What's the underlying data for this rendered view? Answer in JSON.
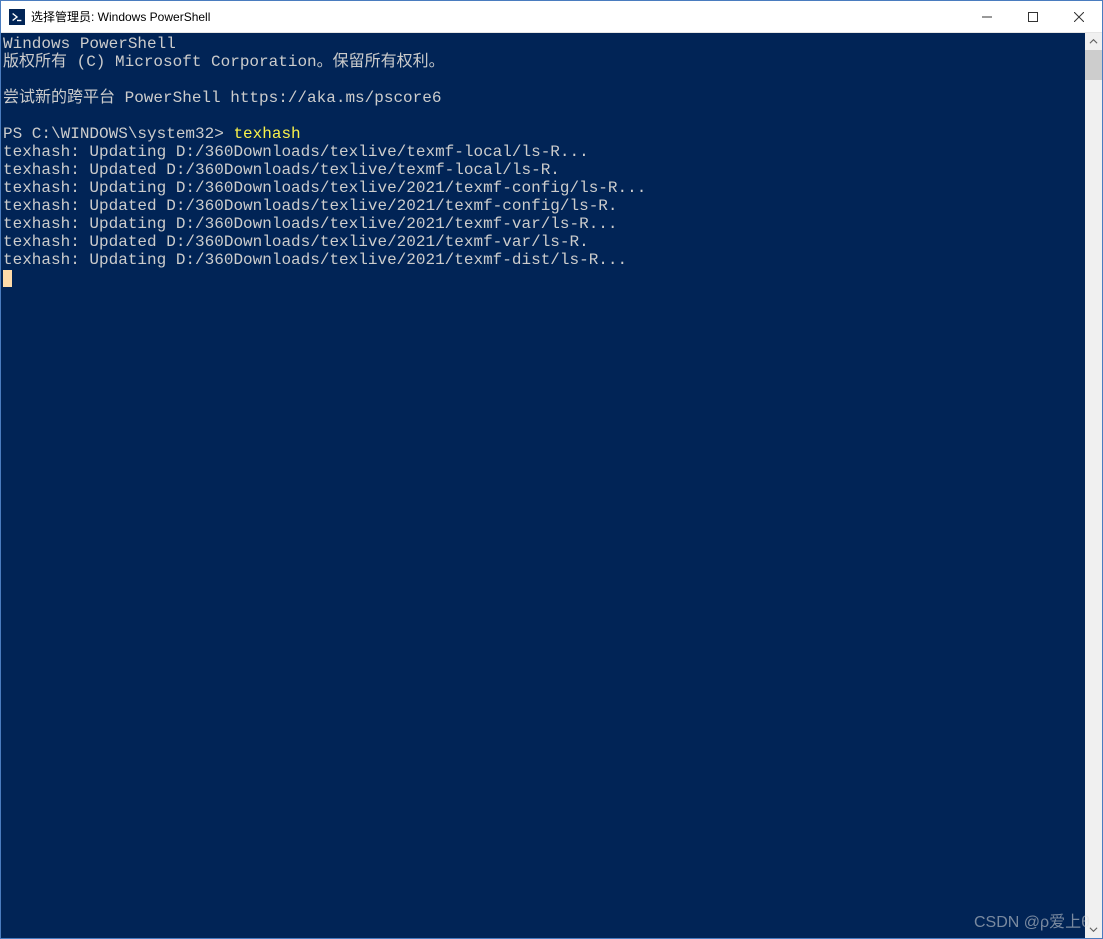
{
  "window": {
    "title": "选择管理员: Windows PowerShell"
  },
  "terminal": {
    "header1": "Windows PowerShell",
    "header2": "版权所有 (C) Microsoft Corporation。保留所有权利。",
    "tryline": "尝试新的跨平台 PowerShell https://aka.ms/pscore6",
    "prompt": "PS C:\\WINDOWS\\system32> ",
    "command": "texhash",
    "output": [
      "texhash: Updating D:/360Downloads/texlive/texmf-local/ls-R...",
      "texhash: Updated D:/360Downloads/texlive/texmf-local/ls-R.",
      "texhash: Updating D:/360Downloads/texlive/2021/texmf-config/ls-R...",
      "texhash: Updated D:/360Downloads/texlive/2021/texmf-config/ls-R.",
      "texhash: Updating D:/360Downloads/texlive/2021/texmf-var/ls-R...",
      "texhash: Updated D:/360Downloads/texlive/2021/texmf-var/ls-R.",
      "texhash: Updating D:/360Downloads/texlive/2021/texmf-dist/ls-R..."
    ]
  },
  "watermark": "CSDN @ρ爱上θ"
}
